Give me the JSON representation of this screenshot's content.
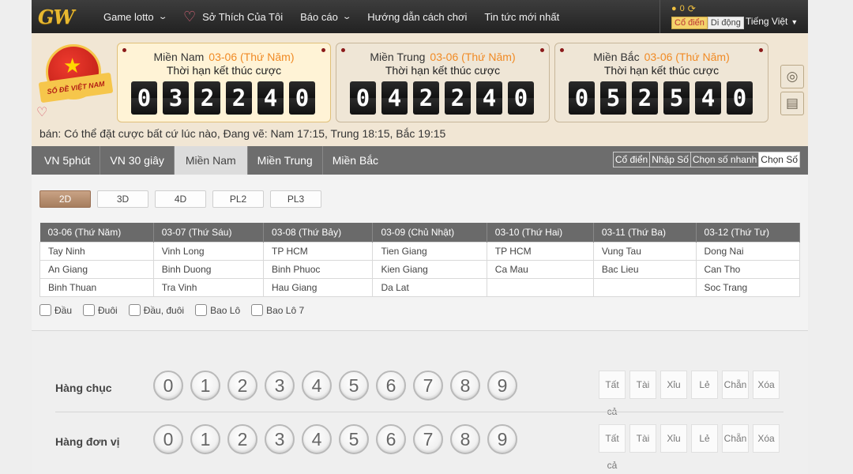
{
  "nav": {
    "logo": "GW",
    "items": [
      {
        "label": "Game lotto",
        "has_dropdown": true
      },
      {
        "label": "Sở Thích Của Tôi",
        "icon": "heart-icon"
      },
      {
        "label": "Báo cáo",
        "has_dropdown": true
      },
      {
        "label": "Hướng dẫn cách chơi"
      },
      {
        "label": "Tin tức mới nhất"
      }
    ],
    "balance": "0",
    "mode_classic": "Cổ điển",
    "mode_mobile": "Di động",
    "language": "Tiếng Việt"
  },
  "header": {
    "emblem_text": "SỐ ĐỀ VIỆT NAM",
    "cards": [
      {
        "region": "Miền Nam",
        "date": "03-06 (Thứ Năm)",
        "caption": "Thời hạn kết thúc cược",
        "digits": [
          "0",
          "3",
          "2",
          "2",
          "4",
          "0"
        ],
        "active": true
      },
      {
        "region": "Miền Trung",
        "date": "03-06 (Thứ Năm)",
        "caption": "Thời hạn kết thúc cược",
        "digits": [
          "0",
          "4",
          "2",
          "2",
          "4",
          "0"
        ],
        "active": false
      },
      {
        "region": "Miền Bắc",
        "date": "03-06 (Thứ Năm)",
        "caption": "Thời hạn kết thúc cược",
        "digits": [
          "0",
          "5",
          "2",
          "5",
          "4",
          "0"
        ],
        "active": false
      }
    ],
    "ticker": "bán: Có thể đặt cược bất cứ lúc nào,   Đang vẽ: Nam 17:15, Trung 18:15, Bắc 19:15",
    "side_icons": [
      "globe-icon",
      "clock-document-icon"
    ]
  },
  "game_tabs": {
    "tabs": [
      "VN 5phút",
      "VN 30 giây",
      "Miền Nam",
      "Miền Trung",
      "Miền Bắc"
    ],
    "active": "Miền Nam",
    "bet_types": [
      "Cổ điển",
      "Nhập Số",
      "Chọn số nhanh",
      "Chọn Số"
    ],
    "active_bet_type": "Chọn Số"
  },
  "sub_tabs": {
    "tabs": [
      "2D",
      "3D",
      "4D",
      "PL2",
      "PL3"
    ],
    "active": "2D"
  },
  "schedule": {
    "headers": [
      "03-06 (Thứ Năm)",
      "03-07 (Thứ Sáu)",
      "03-08 (Thứ Bảy)",
      "03-09 (Chủ Nhật)",
      "03-10 (Thứ Hai)",
      "03-11 (Thứ Ba)",
      "03-12 (Thứ Tư)"
    ],
    "rows": [
      [
        "Tay Ninh",
        "Vinh Long",
        "TP HCM",
        "Tien Giang",
        "TP HCM",
        "Vung Tau",
        "Dong Nai"
      ],
      [
        "An Giang",
        "Binh Duong",
        "Binh Phuoc",
        "Kien Giang",
        "Ca Mau",
        "Bac Lieu",
        "Can Tho"
      ],
      [
        "Binh Thuan",
        "Tra Vinh",
        "Hau Giang",
        "Da Lat",
        "",
        "",
        "Soc Trang"
      ]
    ]
  },
  "checkboxes": [
    "Đầu",
    "Đuôi",
    "Đầu, đuôi",
    "Bao Lô",
    "Bao Lô 7"
  ],
  "picker": {
    "rows": [
      {
        "label": "Hàng chục",
        "numbers": [
          "0",
          "1",
          "2",
          "3",
          "4",
          "5",
          "6",
          "7",
          "8",
          "9"
        ]
      },
      {
        "label": "Hàng đơn vị",
        "numbers": [
          "0",
          "1",
          "2",
          "3",
          "4",
          "5",
          "6",
          "7",
          "8",
          "9"
        ]
      }
    ],
    "quick_buttons": [
      "Tất cả",
      "Tài",
      "Xỉu",
      "Lẻ",
      "Chẵn",
      "Xóa"
    ]
  }
}
